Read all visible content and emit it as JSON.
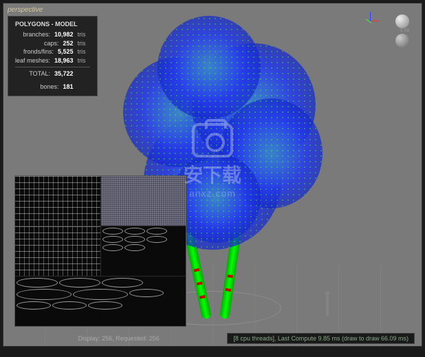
{
  "viewport": {
    "label": "perspective"
  },
  "stats": {
    "title": "POLYGONS - MODEL",
    "rows": [
      {
        "label": "branches:",
        "value": "10,982",
        "unit": "tris"
      },
      {
        "label": "caps:",
        "value": "252",
        "unit": "tris"
      },
      {
        "label": "fronds/fins:",
        "value": "5,525",
        "unit": "tris"
      },
      {
        "label": "leaf meshes:",
        "value": "18,963",
        "unit": "tris"
      }
    ],
    "total": {
      "label": "TOTAL:",
      "value": "35,722",
      "unit": ""
    },
    "bones": {
      "label": "bones:",
      "value": "181",
      "unit": ""
    }
  },
  "gizmo": {
    "scale_label": "0.69"
  },
  "status": {
    "left": "Display: 256, Requested: 256",
    "right": "[8 cpu threads], Last Compute 9.85 ms (draw to draw 66.09 ms)"
  },
  "watermark": {
    "text": "安下载",
    "sub": "anxz.com"
  }
}
